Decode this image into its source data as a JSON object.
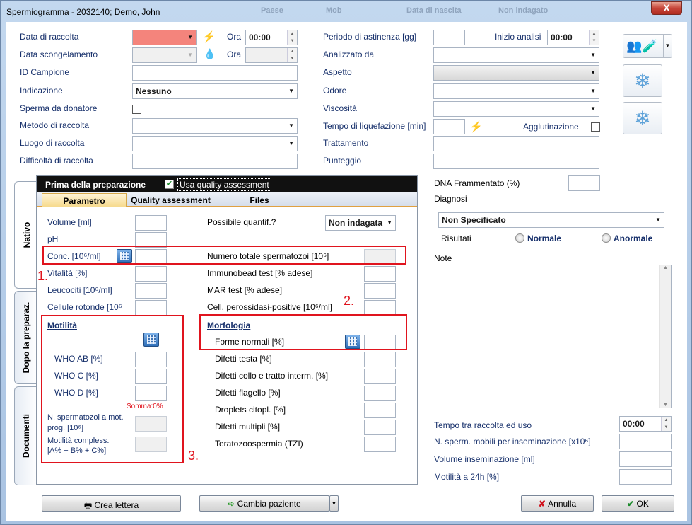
{
  "window": {
    "title": "Spermiogramma - 2032140; Demo, John",
    "ghost_cols": [
      "Paese",
      "Mob",
      "Data di nascita",
      "Non indagato"
    ],
    "close_label": "X"
  },
  "left": {
    "data_raccolta": "Data di raccolta",
    "ora1": "Ora",
    "ora1_value": "00:00",
    "data_scong": "Data scongelamento",
    "ora2": "Ora",
    "id_campione": "ID Campione",
    "indicazione": "Indicazione",
    "indicazione_value": "Nessuno",
    "sperma_donatore": "Sperma da donatore",
    "metodo": "Metodo di raccolta",
    "luogo": "Luogo di raccolta",
    "difficolta": "Difficoltà di raccolta"
  },
  "mid": {
    "periodo": "Periodo di astinenza [gg]",
    "inizio": "Inizio analisi",
    "inizio_value": "00:00",
    "analizzato": "Analizzato da",
    "aspetto": "Aspetto",
    "odore": "Odore",
    "viscosita": "Viscosità",
    "tempo_liq": "Tempo di liquefazione [min]",
    "agglutinazione": "Agglutinazione",
    "trattamento": "Trattamento",
    "punteggio": "Punteggio"
  },
  "panel": {
    "header": "Prima della preparazione",
    "quality_check": "Usa quality assessment",
    "tabs": [
      "Parametro",
      "Quality assessment",
      "Files"
    ],
    "volume": "Volume [ml]",
    "ph": "pH",
    "conc": "Conc. [10⁶/ml]",
    "vitalita": "Vitalità [%]",
    "leucociti": "Leucociti [10⁶/ml]",
    "cellule": "Cellule rotonde [10⁶",
    "possibile": "Possibile quantif.?",
    "possibile_value": "Non indagata",
    "numero_totale": "Numero totale spermatozoi [10⁶]",
    "immunobead": "Immunobead test [% adese]",
    "mar": "MAR test [% adese]",
    "perossidasi": "Cell. perossidasi-positive [10⁶/ml]",
    "motilita": "Motilità",
    "who_ab": "WHO AB [%]",
    "who_c": "WHO C [%]",
    "who_d": "WHO D [%]",
    "somma": "Somma:0%",
    "n_sperm_1": "N. spermatozoi a   mot.",
    "n_sperm_2": "prog. [10⁶]",
    "mot_compl_1": "Motilità compless.",
    "mot_compl_2": "[A% + B% + C%]",
    "morfologia": "Morfologia",
    "forme_normali": "Forme normali [%]",
    "difetti_testa": "Difetti testa [%]",
    "difetti_collo": "Difetti collo e tratto interm. [%]",
    "difetti_flagello": "Difetti flagello [%]",
    "droplets": "Droplets citopl. [%]",
    "difetti_multipli": "Difetti multipli [%]",
    "teratozoo": "Teratozoospermia (TZI)"
  },
  "side_tabs": [
    "Nativo",
    "Dopo la preparaz.",
    "Documenti"
  ],
  "annotations": [
    "1.",
    "2.",
    "3."
  ],
  "right": {
    "dna": "DNA Frammentato (%)",
    "diagnosi": "Diagnosi",
    "diagnosi_value": "Non Specificato",
    "risultati": "Risultati",
    "normale": "Normale",
    "anormale": "Anormale",
    "note": "Note",
    "tempo_uso": "Tempo tra raccolta ed uso",
    "tempo_uso_value": "00:00",
    "n_mobili": "N. sperm. mobili per inseminazione [x10⁶]",
    "volume_ins": "Volume inseminazione [ml]",
    "motilita24": "Motilità a 24h [%]"
  },
  "buttons": {
    "crea": "Crea lettera",
    "cambia": "Cambia paziente",
    "annulla": "Annulla",
    "ok": "OK"
  },
  "colors": {
    "required_field": "#f4847c",
    "annotation_red": "#e0141e",
    "tab_active": "#f6d98a"
  }
}
